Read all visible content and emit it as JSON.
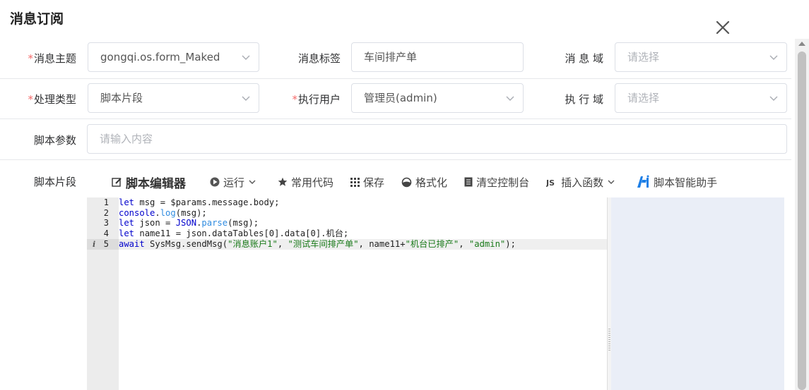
{
  "dialog": {
    "title": "消息订阅"
  },
  "form": {
    "topic": {
      "label": "消息主题",
      "value": "gongqi.os.form_Maked"
    },
    "tag": {
      "label": "消息标签",
      "value": "车间排产单"
    },
    "domain": {
      "label": "消 息 域",
      "placeholder": "请选择"
    },
    "handle_type": {
      "label": "处理类型",
      "value": "脚本片段"
    },
    "exec_user": {
      "label": "执行用户",
      "value": "管理员(admin)"
    },
    "exec_domain": {
      "label": "执 行 域",
      "placeholder": "请选择"
    },
    "script_params": {
      "label": "脚本参数",
      "placeholder": "请输入内容"
    },
    "script_snippet": {
      "label": "脚本片段"
    }
  },
  "toolbar": {
    "editor_title": "脚本编辑器",
    "run": "运行",
    "common_code": "常用代码",
    "save": "保存",
    "format": "格式化",
    "clear_console": "清空控制台",
    "insert_function": "插入函数",
    "ai_assistant": "脚本智能助手"
  },
  "editor": {
    "line_numbers": [
      "1",
      "2",
      "3",
      "4",
      "5"
    ],
    "lines": [
      "let msg = $params.message.body;",
      "console.log(msg);",
      "let json = JSON.parse(msg);",
      "let name11 = json.dataTables[0].data[0].机台;",
      "await SysMsg.sendMsg(\"消息账户1\", \"测试车间排产单\", name11+\"机台已排产\", \"admin\");"
    ],
    "active_line": 5
  },
  "colors": {
    "required": "#f56c6c",
    "keyword": "#0000cc",
    "string": "#1a7a1a",
    "function": "#2f8be0",
    "right_pane": "#eaeef7",
    "ai_icon": "#1e7fe6"
  }
}
